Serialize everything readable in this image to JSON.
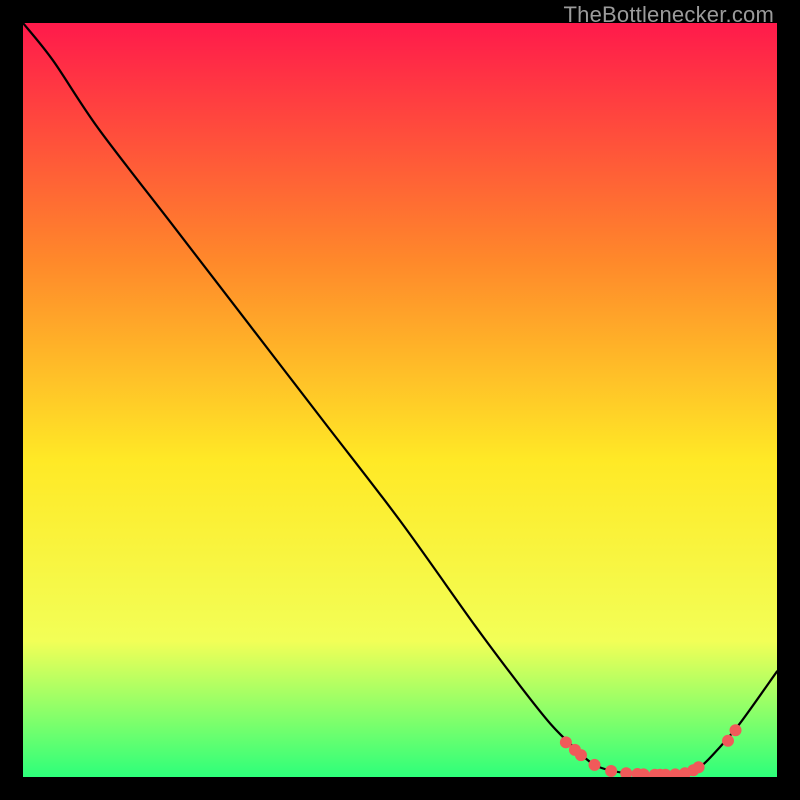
{
  "watermark": "TheBottlenecker.com",
  "chart_data": {
    "type": "line",
    "title": "",
    "xlabel": "",
    "ylabel": "",
    "xlim": [
      0,
      100
    ],
    "ylim": [
      0,
      100
    ],
    "background_gradient": {
      "top": "#ff1a4b",
      "mid_upper": "#ff8a2a",
      "mid": "#ffe926",
      "mid_lower": "#f2ff57",
      "bottom": "#2dff7a"
    },
    "curve": {
      "description": "Bottleneck percentage vs parameter, V-shaped with minimum basin around x≈76-90",
      "x": [
        0,
        4,
        10,
        20,
        30,
        40,
        50,
        60,
        66,
        70,
        73,
        76,
        80,
        85,
        88,
        90,
        92,
        95,
        100
      ],
      "y": [
        100,
        95,
        86,
        73,
        60,
        47,
        34,
        20,
        12,
        7,
        4,
        1.5,
        0.5,
        0.3,
        0.5,
        1.5,
        3.5,
        7,
        14
      ]
    },
    "markers": {
      "description": "Highlighted red dots near the basin and right slope",
      "points": [
        {
          "x": 72.0,
          "y": 4.6
        },
        {
          "x": 73.2,
          "y": 3.6
        },
        {
          "x": 74.0,
          "y": 2.9
        },
        {
          "x": 75.8,
          "y": 1.6
        },
        {
          "x": 78.0,
          "y": 0.8
        },
        {
          "x": 80.0,
          "y": 0.5
        },
        {
          "x": 81.5,
          "y": 0.4
        },
        {
          "x": 82.3,
          "y": 0.35
        },
        {
          "x": 83.8,
          "y": 0.3
        },
        {
          "x": 84.5,
          "y": 0.3
        },
        {
          "x": 85.2,
          "y": 0.3
        },
        {
          "x": 86.5,
          "y": 0.35
        },
        {
          "x": 87.8,
          "y": 0.5
        },
        {
          "x": 88.9,
          "y": 0.9
        },
        {
          "x": 89.6,
          "y": 1.3
        },
        {
          "x": 93.5,
          "y": 4.8
        },
        {
          "x": 94.5,
          "y": 6.2
        }
      ],
      "color": "#f05a5a",
      "radius": 6
    }
  }
}
